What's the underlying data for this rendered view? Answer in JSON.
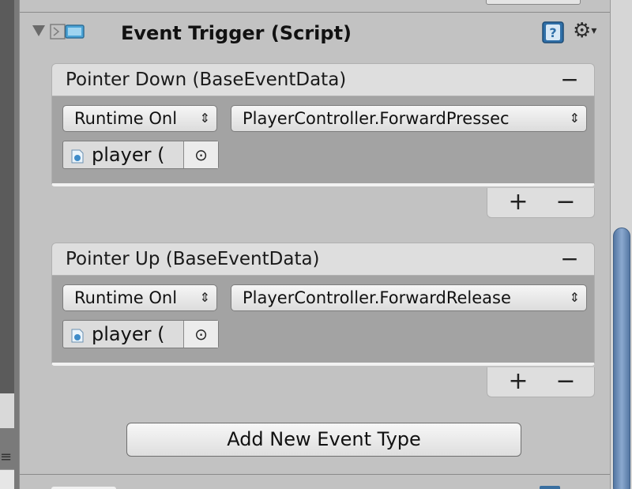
{
  "component": {
    "title": "Event Trigger (Script)",
    "icons": {
      "foldout": "foldout-arrow-icon",
      "script": "script-icon",
      "help": "help-icon",
      "settings": "gear-icon"
    }
  },
  "events": [
    {
      "title": "Pointer Down (BaseEventData)",
      "remove_label": "−",
      "mode": "Runtime Onl",
      "function": "PlayerController.ForwardPressec",
      "target": "player (",
      "picker": "⊙",
      "add_label": "+",
      "remove_listener_label": "−"
    },
    {
      "title": "Pointer Up (BaseEventData)",
      "remove_label": "−",
      "mode": "Runtime Onl",
      "function": "PlayerController.ForwardRelease",
      "target": "player (",
      "picker": "⊙",
      "add_label": "+",
      "remove_listener_label": "−"
    }
  ],
  "add_event_button": "Add New Event Type",
  "dropdown_arrows": "⇕",
  "colors": {
    "panel_bg": "#c2c2c2",
    "event_header_bg": "#dedede",
    "event_body_bg": "#a3a3a3",
    "scroll_thumb": "#6b8cb8"
  }
}
